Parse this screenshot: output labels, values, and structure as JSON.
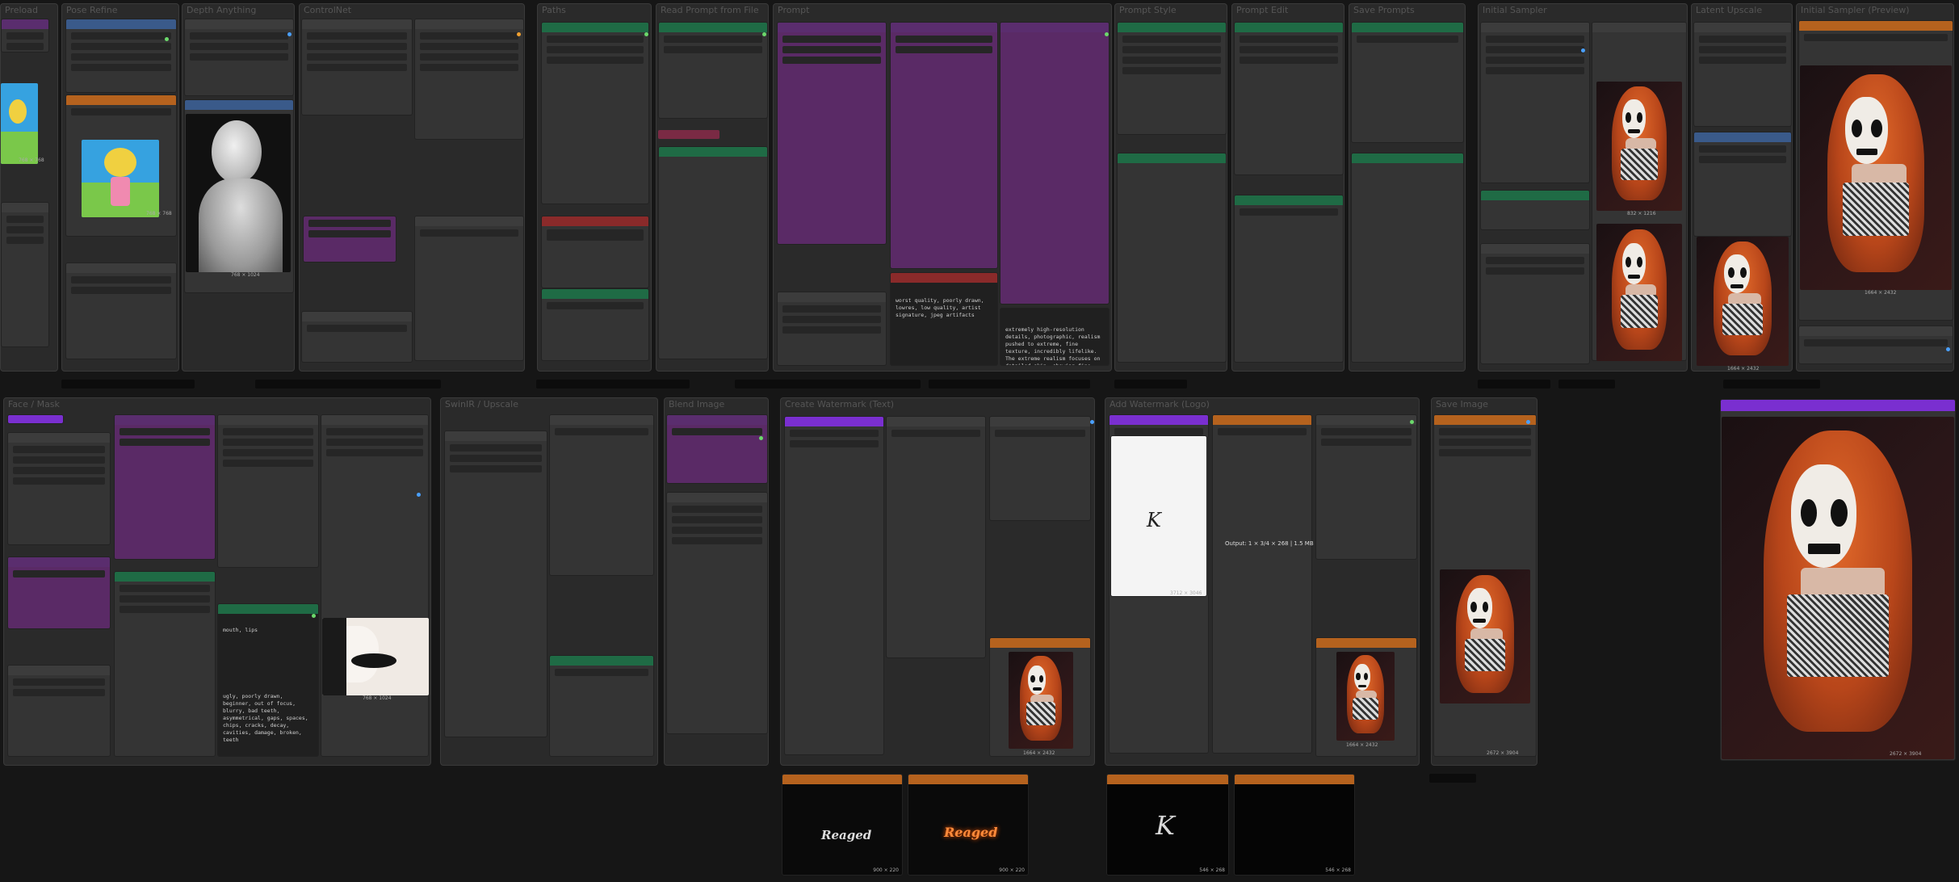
{
  "groups": {
    "g_left": "Preload",
    "g_pose": "Pose Refine",
    "g_depth": "Depth Anything",
    "g_controlnet": "ControlNet",
    "g_paths": "Paths",
    "g_promptfile": "Read Prompt from File",
    "g_prompt": "Prompt",
    "g_style": "Prompt Style",
    "g_promptedit": "Prompt Edit",
    "g_prompts": "Save Prompts",
    "g_kinit": "Initial Sampler",
    "g_latent": "Latent Upscale",
    "g_kpreview": "Initial Sampler (Preview)",
    "g_facemask": "Face / Mask",
    "g_upscale": "SwinIR / Upscale",
    "g_blend": "Blend Image",
    "g_watermark": "Create Watermark (Text)",
    "g_watermark2": "Add Watermark (Logo)",
    "g_save": "Save Image"
  },
  "dimensions": {
    "pose1": "768 × 768",
    "pose2": "768 × 768",
    "depth": "768 × 1024",
    "k1": "832 × 1216",
    "k2": "832 × 1216",
    "k3": "832 × 1216",
    "latent": "1664 × 2432",
    "preview": "1664 × 2432",
    "mouth": "768 × 1024",
    "wm_logo": "3712 × 3046",
    "wm_text1": "900 × 220",
    "wm_text2": "900 × 220",
    "wm_k1": "546 × 268",
    "wm_k2": "546 × 268",
    "wm_portrait": "1664 × 2432",
    "wm_portrait2": "1664 × 2432",
    "save_final": "2672 × 3904",
    "final": "2672 × 3904"
  },
  "prompts": {
    "negative": "worst quality, poorly drawn, lowres, low quality, artist signature, jpeg artifacts",
    "positive": "extremely high-resolution details, photographic, realism pushed to extreme, fine texture, incredibly lifelike. The extreme realism focuses on detailed skin, showing fine textures and",
    "mask": "mouth, lips",
    "mask_negative": "ugly, poorly drawn, beginner, out of focus, blurry, bad teeth, asymmetrical, gaps, spaces, chips, cracks, decay, cavities, damage, broken, teeth"
  },
  "watermark": {
    "text": "Reaged",
    "output": "Output: 1 × 3/4 × 268 | 1.5 MB"
  },
  "colors": {
    "background": "#161616",
    "group": "#2a2a2a",
    "node": "#343434",
    "purple": "#5a2a66",
    "green": "#1f6b45",
    "orange": "#b5621e",
    "red": "#8a2a2a",
    "violet": "#7a2fd0",
    "accent_green": "#6bd96b",
    "accent_blue": "#4aa0ff"
  },
  "icons": [
    "pose-figure-icon",
    "depth-figure-icon",
    "watermark-k-icon",
    "portrait-image",
    "play-icon"
  ]
}
